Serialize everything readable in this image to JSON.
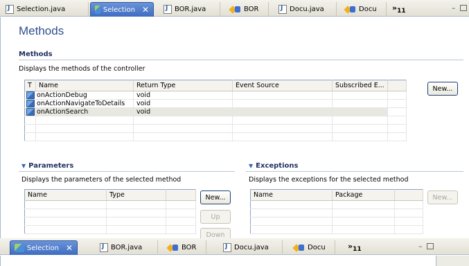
{
  "top_tabs": [
    {
      "label": "Selection.java",
      "icon": "java-file-icon",
      "active": false
    },
    {
      "label": "Selection",
      "icon": "controller-icon",
      "active": true,
      "close": "✕"
    },
    {
      "label": "BOR.java",
      "icon": "java-file-icon",
      "active": false
    },
    {
      "label": "BOR",
      "icon": "bor-icon",
      "active": false
    },
    {
      "label": "Docu.java",
      "icon": "java-file-icon",
      "active": false
    },
    {
      "label": "Docu",
      "icon": "bor-icon",
      "active": false
    }
  ],
  "overflow": {
    "symbol": "»",
    "count": "11"
  },
  "page_title": "Methods",
  "methods": {
    "title": "Methods",
    "description": "Displays the methods of the controller",
    "columns": [
      "T",
      "Name",
      "Return Type",
      "Event Source",
      "Subscribed E..."
    ],
    "rows": [
      {
        "name": "onActionDebug",
        "return_type": "void"
      },
      {
        "name": "onActionNavigateToDetails",
        "return_type": "void"
      },
      {
        "name": "onActionSearch",
        "return_type": "void"
      }
    ],
    "new_label": "New..."
  },
  "parameters": {
    "title": "Parameters",
    "description": "Displays the parameters of the selected method",
    "columns": [
      "Name",
      "Type"
    ],
    "new_label": "New...",
    "up_label": "Up",
    "down_label": "Down"
  },
  "exceptions": {
    "title": "Exceptions",
    "description": "Displays the exceptions for the selected method",
    "columns": [
      "Name",
      "Package"
    ],
    "new_label": "New..."
  },
  "bottom_tabs": [
    {
      "label": "Selection",
      "icon": "controller-icon",
      "active": true,
      "close": "✕"
    },
    {
      "label": "BOR.java",
      "icon": "java-file-icon",
      "active": false
    },
    {
      "label": "BOR",
      "icon": "bor-icon",
      "active": false
    },
    {
      "label": "Docu.java",
      "icon": "java-file-icon",
      "active": false
    },
    {
      "label": "Docu",
      "icon": "bor-icon",
      "active": false
    }
  ],
  "colors": {
    "accent": "#3e6cc0",
    "title": "#2f4f8f",
    "section": "#1f2f5f"
  }
}
